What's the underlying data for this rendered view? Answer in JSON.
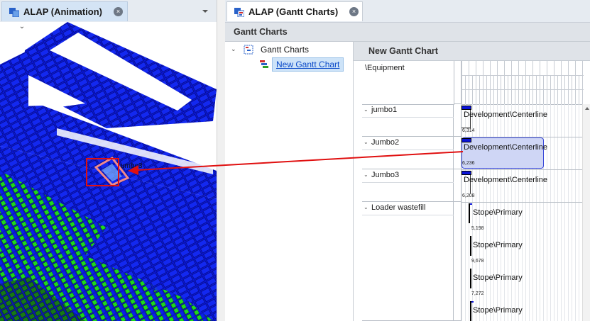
{
  "left_tab": {
    "title": "ALAP (Animation)",
    "close_glyph": "×"
  },
  "right_tab": {
    "title": "ALAP (Gantt Charts)",
    "close_glyph": "×"
  },
  "panel": {
    "title": "Gantt Charts"
  },
  "tree": {
    "root": {
      "label": "Gantt Charts",
      "expander": "⌄"
    },
    "child": {
      "label": "New Gantt Chart"
    }
  },
  "gantt": {
    "title": "New Gantt Chart",
    "column_header": "\\Equipment",
    "rows": [
      {
        "name": "jumbo1",
        "task": "Development\\Centerline",
        "value": "6,314"
      },
      {
        "name": "Jumbo2",
        "task": "Development\\Centerline",
        "value": "6,236"
      },
      {
        "name": "Jumbo3",
        "task": "Development\\Centerline",
        "value": "6,208"
      },
      {
        "name": "Loader wastefill",
        "tasks": [
          {
            "task": "Stope\\Primary",
            "value": "5,198"
          },
          {
            "task": "Stope\\Primary",
            "value": "9,678"
          },
          {
            "task": "Stope\\Primary",
            "value": "7,272"
          },
          {
            "task": "Stope\\Primary",
            "value": ""
          }
        ]
      }
    ]
  },
  "viewport": {
    "label": "Jumbo3"
  },
  "colors": {
    "accent": "#0a4ac8",
    "bar_blue": "#0a13d8",
    "arrow": "#e01010",
    "selection": "#cfd6f5"
  }
}
